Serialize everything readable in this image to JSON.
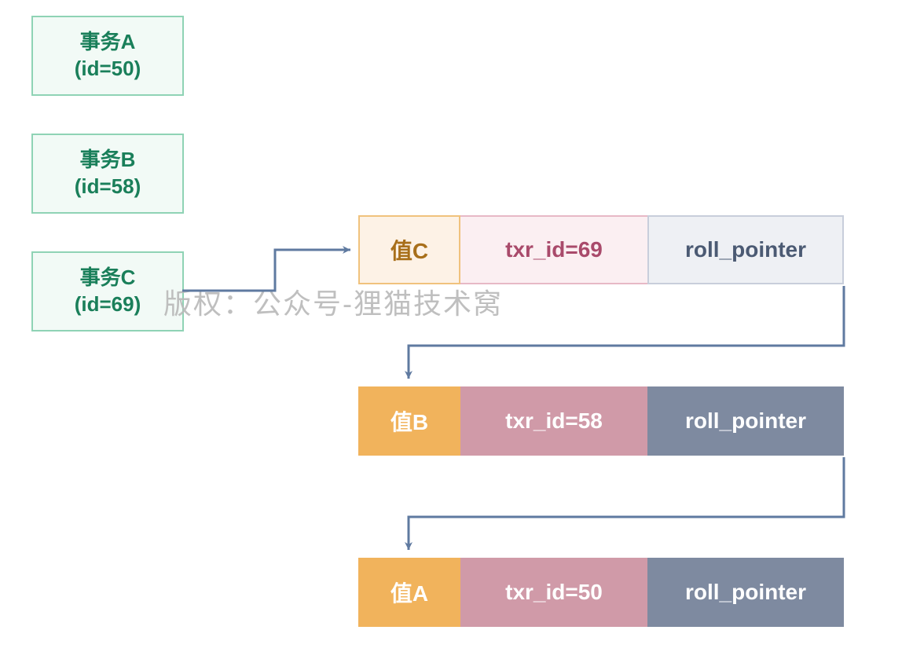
{
  "transactions": {
    "a": {
      "label": "事务A",
      "id_label": "(id=50)",
      "id": 50
    },
    "b": {
      "label": "事务B",
      "id_label": "(id=58)",
      "id": 58
    },
    "c": {
      "label": "事务C",
      "id_label": "(id=69)",
      "id": 69
    }
  },
  "versions": {
    "c": {
      "value_label": "值C",
      "txr_label": "txr_id=69",
      "roll_label": "roll_pointer",
      "txr_id": 69
    },
    "b": {
      "value_label": "值B",
      "txr_label": "txr_id=58",
      "roll_label": "roll_pointer",
      "txr_id": 58
    },
    "a": {
      "value_label": "值A",
      "txr_label": "txr_id=50",
      "roll_label": "roll_pointer",
      "txr_id": 50
    }
  },
  "watermark": "版权：公众号-狸猫技术窝",
  "colors": {
    "tx_border": "#8fd3b5",
    "tx_bg": "#f2faf6",
    "tx_text": "#1a7f5a",
    "arrow": "#5f7aa0",
    "val_light_bg": "#fdf2e6",
    "txr_light_bg": "#fbeff2",
    "rp_light_bg": "#eef0f4",
    "val_bg": "#f1b35c",
    "txr_bg": "#d09aa8",
    "rp_bg": "#7e8aa0"
  }
}
